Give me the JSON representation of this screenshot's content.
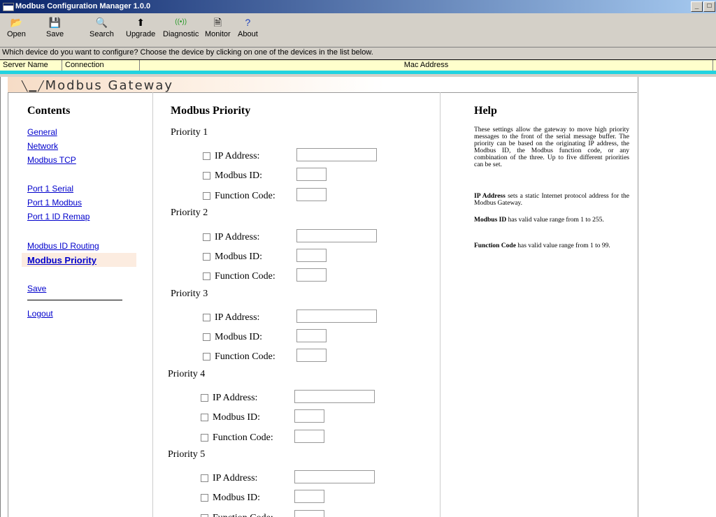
{
  "window": {
    "title": "Modbus Configuration Manager 1.0.0"
  },
  "toolbar": [
    {
      "label": "Open",
      "icon": "folder-icon"
    },
    {
      "label": "Save",
      "icon": "floppy-icon"
    },
    {
      "label": "Search",
      "icon": "search-icon"
    },
    {
      "label": "Upgrade",
      "icon": "upgrade-icon"
    },
    {
      "label": "Diagnostic",
      "icon": "antenna-icon"
    },
    {
      "label": "Monitor",
      "icon": "monitor-icon"
    },
    {
      "label": "About",
      "icon": "question-icon"
    }
  ],
  "prompt": "Which device do you want to configure? Choose the device by clicking on one of the devices in the list below.",
  "device_list": {
    "columns": [
      "Server Name",
      "Connection",
      "Mac Address"
    ]
  },
  "banner": {
    "logo": "Modbus Gateway"
  },
  "contents": {
    "title": "Contents",
    "items": [
      "General",
      "Network",
      "Modbus TCP",
      "Port 1 Serial",
      "Port 1 Modbus",
      "Port 1 ID Remap",
      "Modbus ID Routing",
      "Modbus Priority",
      "Save",
      "Logout"
    ]
  },
  "main": {
    "title": "Modbus Priority",
    "priorities": [
      "Priority 1",
      "Priority 2",
      "Priority 3",
      "Priority 4",
      "Priority 5"
    ],
    "fields": [
      "IP Address:",
      "Modbus ID:",
      "Function Code:"
    ]
  },
  "help": {
    "title": "Help",
    "intro": "These settings allow the gateway to move high priority messages to the front of the serial message buffer. The priority can be based on the originating IP address, the Modbus ID, the Modbus function code, or any combination of the three. Up to five different priorities can be set.",
    "ip_term": "IP Address",
    "ip_text": " sets a static Internet protocol address for the Modbus Gateway.",
    "id_term": "Modbus ID",
    "id_text": " has valid value range from 1 to 255.",
    "fc_term": "Function Code",
    "fc_text": " has valid value range from 1 to 99."
  }
}
